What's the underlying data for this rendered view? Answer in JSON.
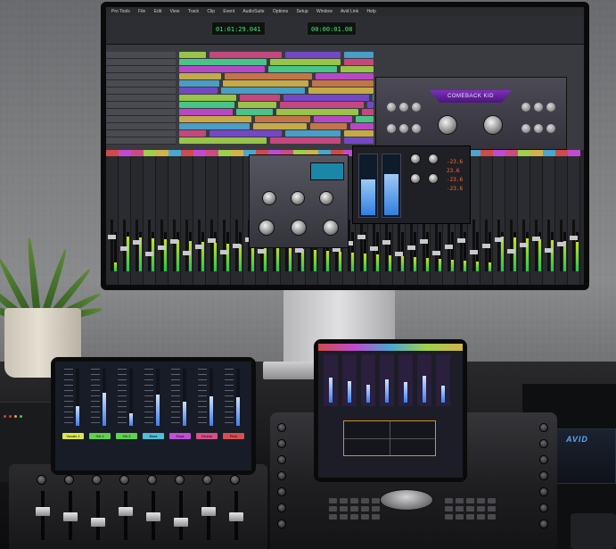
{
  "scene": "studio-desk",
  "monitor": {
    "menu_items": [
      "Pro Tools",
      "File",
      "Edit",
      "View",
      "Track",
      "Clip",
      "Event",
      "AudioSuite",
      "Options",
      "Setup",
      "Window",
      "Avid Link",
      "Help"
    ],
    "counter_main": "01:01:29.041",
    "counter_sub": "00:00:01.08",
    "plugin_name": "COMEBACK KID",
    "readouts": [
      "-23.6",
      "23.6",
      "-23.6",
      "-23.6"
    ]
  },
  "left_tablet": {
    "channels": [
      {
        "name": "Vocals 1",
        "level": 0.34,
        "color": "#d9e84c"
      },
      {
        "name": "Gtr 1",
        "level": 0.58,
        "color": "#5fd24f"
      },
      {
        "name": "Gtr 2",
        "level": 0.22,
        "color": "#5fd24f"
      },
      {
        "name": "Bass",
        "level": 0.55,
        "color": "#4fbfd8"
      },
      {
        "name": "Keys",
        "level": 0.42,
        "color": "#c14fd8"
      },
      {
        "name": "Drums",
        "level": 0.52,
        "color": "#d84f8a"
      },
      {
        "name": "Perc",
        "level": 0.5,
        "color": "#d84f4f"
      }
    ]
  },
  "right_tablet": {
    "levels": [
      0.55,
      0.48,
      0.4,
      0.52,
      0.45,
      0.6,
      0.38
    ]
  },
  "rack": {
    "logo": "AVID"
  },
  "colors": {
    "accent_purple": "#8e3ad0",
    "meter_green": "#1ec94a",
    "panner_orange": "#d48e2f"
  }
}
